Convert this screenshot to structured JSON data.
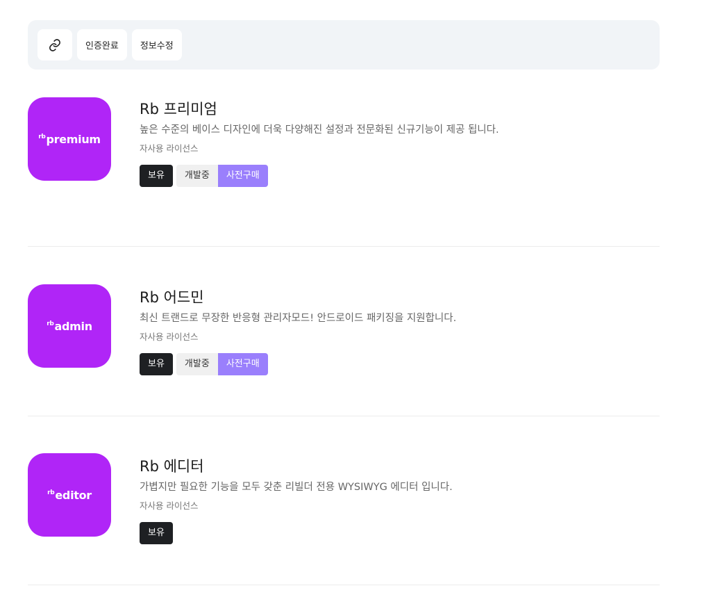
{
  "toolbar": {
    "link_icon": "link-icon",
    "verified_label": "인증완료",
    "edit_label": "정보수정"
  },
  "products": [
    {
      "logo_prefix": "rb",
      "logo_word": "premium",
      "title": "Rb 프리미엄",
      "description": "높은 수준의 베이스 디자인에 더욱 다양해진 설정과 전문화된 신규기능이 제공 됩니다.",
      "license": "자사용 라이선스",
      "badges": {
        "owned": "보유",
        "developing": "개발중",
        "preorder": "사전구매"
      }
    },
    {
      "logo_prefix": "rb",
      "logo_word": "admin",
      "title": "Rb 어드민",
      "description": "최신 트랜드로 무장한 반응형 관리자모드! 안드로이드 패키징을 지원합니다.",
      "license": "자사용 라이선스",
      "badges": {
        "owned": "보유",
        "developing": "개발중",
        "preorder": "사전구매"
      }
    },
    {
      "logo_prefix": "rb",
      "logo_word": "editor",
      "title": "Rb 에디터",
      "description": "가볍지만 필요한 기능을 모두 갖춘 리빌더 전용 WYSIWYG 에디터 입니다.",
      "license": "자사용 라이선스",
      "badges": {
        "owned": "보유"
      }
    }
  ],
  "colors": {
    "logo_bg": "#b025f7",
    "owned_badge": "#1e2023",
    "preorder_badge": "#9a7ffc",
    "toolbar_bg": "#f1f4f7"
  }
}
